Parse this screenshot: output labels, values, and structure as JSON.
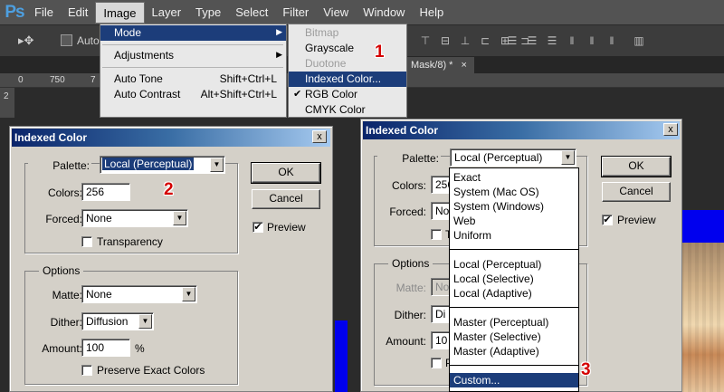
{
  "app": {
    "logo": "Ps"
  },
  "menubar": {
    "items": [
      "File",
      "Edit",
      "Image",
      "Layer",
      "Type",
      "Select",
      "Filter",
      "View",
      "Window",
      "Help"
    ],
    "active": "Image"
  },
  "optionsbar": {
    "tool_icon": "move-tool-icon",
    "auto_label": "Auto-"
  },
  "document_tab": {
    "label": "Mask/8) *",
    "close": "×"
  },
  "ruler": {
    "numbers": [
      "0",
      "750",
      "7"
    ],
    "vruler_glyph": "2"
  },
  "image_menu": {
    "items": [
      {
        "label": "Mode",
        "shortcut": "",
        "submenu": true,
        "highlighted": true
      },
      {
        "label": "Adjustments",
        "shortcut": "",
        "submenu": true
      },
      {
        "label": "Auto Tone",
        "shortcut": "Shift+Ctrl+L"
      },
      {
        "label": "Auto Contrast",
        "shortcut": "Alt+Shift+Ctrl+L"
      }
    ]
  },
  "mode_submenu": {
    "items": [
      {
        "label": "Bitmap",
        "disabled": true
      },
      {
        "label": "Grayscale"
      },
      {
        "label": "Duotone",
        "disabled": true
      },
      {
        "label": "Indexed Color...",
        "highlighted": true
      },
      {
        "label": "RGB Color",
        "checked": true
      },
      {
        "label": "CMYK Color"
      }
    ]
  },
  "badges": [
    "1",
    "2",
    "3"
  ],
  "dialog_left": {
    "title": "Indexed Color",
    "close": "x",
    "palette_label": "Palette:",
    "palette_value": "Local (Perceptual)",
    "colors_label": "Colors:",
    "colors_value": "256",
    "forced_label": "Forced:",
    "forced_value": "None",
    "transparency_label": "Transparency",
    "options_title": "Options",
    "matte_label": "Matte:",
    "matte_value": "None",
    "dither_label": "Dither:",
    "dither_value": "Diffusion",
    "amount_label": "Amount:",
    "amount_value": "100",
    "amount_unit": "%",
    "preserve_label": "Preserve Exact Colors",
    "ok_label": "OK",
    "cancel_label": "Cancel",
    "preview_label": "Preview",
    "check_glyph": "✔"
  },
  "dialog_right": {
    "title": "Indexed Color",
    "close": "x",
    "palette_label": "Palette:",
    "palette_value": "Local (Perceptual)",
    "colors_label": "Colors:",
    "colors_value_partial": "256",
    "forced_label": "Forced:",
    "forced_value_partial": "No",
    "transparency_partial": "T",
    "options_title": "Options",
    "matte_label": "Matte:",
    "matte_value_partial": "No",
    "dither_label": "Dither:",
    "dither_value_partial": "Di",
    "amount_label": "Amount:",
    "amount_value_partial": "10",
    "preserve_partial": "P",
    "ok_label": "OK",
    "cancel_label": "Cancel",
    "preview_label": "Preview",
    "check_glyph": "✔"
  },
  "palette_options": {
    "group1": [
      "Exact",
      "System (Mac OS)",
      "System (Windows)",
      "Web",
      "Uniform"
    ],
    "group2": [
      "Local (Perceptual)",
      "Local (Selective)",
      "Local (Adaptive)"
    ],
    "group3": [
      "Master (Perceptual)",
      "Master (Selective)",
      "Master (Adaptive)"
    ],
    "custom": "Custom..."
  },
  "colors": {
    "accent_blue": "#1c3d7a",
    "badge_red": "#d40000",
    "canvas_blue": "#0000ee"
  }
}
